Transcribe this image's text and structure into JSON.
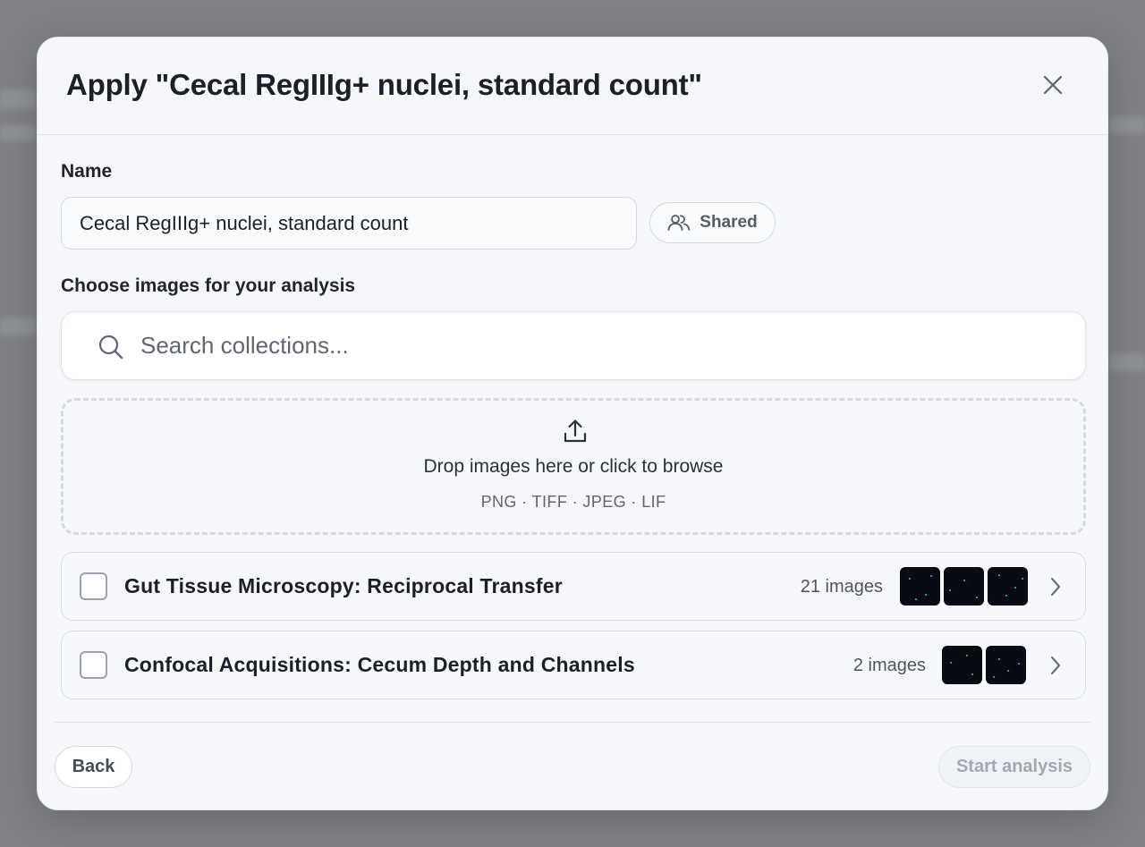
{
  "modal": {
    "title": "Apply \"Cecal RegIIIg+ nuclei, standard count\""
  },
  "name_field": {
    "label": "Name",
    "value": "Cecal RegIIIg+ nuclei, standard count"
  },
  "shared_button": {
    "label": "Shared",
    "icon": "users-icon"
  },
  "images_section": {
    "label": "Choose images for your analysis"
  },
  "search": {
    "placeholder": "Search collections...",
    "icon": "search-icon"
  },
  "dropzone": {
    "text": "Drop images here or click to browse",
    "formats": "PNG · TIFF · JPEG · LIF",
    "icon": "upload-icon"
  },
  "collections": [
    {
      "title": "Gut Tissue Microscopy: Reciprocal Transfer",
      "count": "21 images",
      "thumbnails": 3,
      "checked": false
    },
    {
      "title": "Confocal Acquisitions: Cecum Depth and Channels",
      "count": "2 images",
      "thumbnails": 2,
      "checked": false
    }
  ],
  "footer": {
    "back_label": "Back",
    "start_label": "Start analysis",
    "start_enabled": false
  },
  "colors": {
    "thumbnail_bg": "#060b14",
    "thumbnail_dots": "#2fd0b0",
    "disabled_text": "#a2a8b2"
  }
}
